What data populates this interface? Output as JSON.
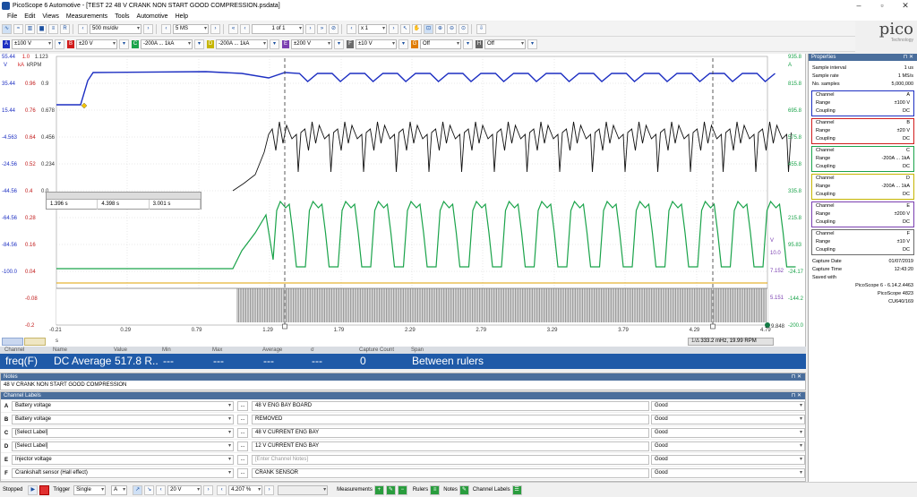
{
  "window": {
    "title": "PicoScope 6 Automotive - [TEST 22 48 V CRANK NON START GOOD COMPRESSION.psdata]",
    "logo_text": "pico",
    "logo_sub": "Technology"
  },
  "menu": [
    "File",
    "Edit",
    "Views",
    "Measurements",
    "Tools",
    "Automotive",
    "Help"
  ],
  "toolbar": {
    "timebase": "500 ms/div",
    "samples": "5 MS",
    "buffer": "1 of 1",
    "zoom": "x 1"
  },
  "channels_toolbar": [
    {
      "letter": "A",
      "range": "±100 V",
      "color": "#1d2fc2"
    },
    {
      "letter": "B",
      "range": "±20 V",
      "color": "#d11c1c"
    },
    {
      "letter": "C",
      "range": "-200A ... 1kA",
      "color": "#1aa34a"
    },
    {
      "letter": "D",
      "range": "-200A ... 1kA",
      "color": "#c6b500"
    },
    {
      "letter": "E",
      "range": "±200 V",
      "color": "#7a3fb0"
    },
    {
      "letter": "F",
      "range": "±10 V",
      "color": "#6b6b6b"
    },
    {
      "letter": "G",
      "range": "Off",
      "color": "#e07b00"
    },
    {
      "letter": "H",
      "range": "Off",
      "color": "#666666"
    }
  ],
  "scope": {
    "left_units": {
      "v1": "V",
      "v2": "kA",
      "v3": "kRPM"
    },
    "axis_a": [
      "35.44",
      "15.44",
      "-4.563",
      "-24.56",
      "-44.56",
      "-64.56",
      "-84.56",
      "-100.0"
    ],
    "axis_b": [
      "0.96",
      "0.76",
      "0.64",
      "0.52",
      "0.4",
      "0.28",
      "0.16",
      "0.04",
      "-0.08",
      "-0.2"
    ],
    "axis_c": [
      "0.9",
      "0.678",
      "0.456",
      "0.234",
      "0.0"
    ],
    "axis_top": {
      "a": "55.44",
      "b": "1.0",
      "c": "1.123"
    },
    "axis_right": [
      "815.8",
      "695.8",
      "575.8",
      "455.8",
      "335.8",
      "215.8",
      "95.83",
      "-24.17",
      "-144.2",
      "-200.0"
    ],
    "axis_right_top": "935.8",
    "axis_right_units": "A",
    "axis_right_b": [
      "10.0",
      "7.152",
      "5.151"
    ],
    "axis_right_b_unit": "V",
    "x_ticks": [
      "-0.21",
      "0.29",
      "0.79",
      "1.29",
      "1.79",
      "2.29",
      "2.79",
      "3.29",
      "3.79",
      "4.29",
      "4.79"
    ],
    "x_unit": "s",
    "ruler_box": {
      "c1": "1.396 s",
      "c2": "4.398 s",
      "c3": "3.001 s"
    },
    "freq_readout": "333.2 mHz, 19.99 RPM",
    "marker_end": "9.848"
  },
  "measurements": {
    "headers": [
      "Channel",
      "Name",
      "Value",
      "Min",
      "Max",
      "Average",
      "σ",
      "Capture Count",
      "Span"
    ],
    "row": [
      "freq(F)",
      "DC Average",
      "517.8 R...",
      "---",
      "---",
      "---",
      "---",
      "0",
      "Between rulers"
    ]
  },
  "notes": {
    "title": "Notes",
    "text": "48 V CRANK NON START GOOD COMPRESSION"
  },
  "channel_labels": {
    "title": "Channel Labels",
    "rows": [
      {
        "letter": "A",
        "label": "Battery voltage",
        "note": "48 V ENG BAY BOARD",
        "status": "Good"
      },
      {
        "letter": "B",
        "label": "Battery voltage",
        "note": "REMOVED",
        "status": "Good"
      },
      {
        "letter": "C",
        "label": "[Select Label]",
        "note": "48 V CURRENT ENG BAY",
        "status": "Good"
      },
      {
        "letter": "D",
        "label": "[Select Label]",
        "note": "12 V CURRENT ENG BAY",
        "status": "Good"
      },
      {
        "letter": "E",
        "label": "Injector voltage",
        "note": "[Enter Channel Notes]",
        "status": "Good"
      },
      {
        "letter": "F",
        "label": "Crankshaft sensor (Hall effect)",
        "note": "CRANK SENSOR",
        "status": "Good"
      }
    ],
    "more_btn": "..."
  },
  "statusbar": {
    "state": "Stopped",
    "trigger_label": "Trigger",
    "trigger_mode": "Single",
    "trigger_channel": "A",
    "trigger_level": "20 V",
    "pretrigger": "4.207 %",
    "measurements": "Measurements",
    "rulers": "Rulers",
    "notes": "Notes",
    "channel_labels": "Channel Labels"
  },
  "properties": {
    "title": "Properties",
    "general": [
      {
        "k": "Sample interval",
        "v": "1 us"
      },
      {
        "k": "Sample rate",
        "v": "1 MS/s"
      },
      {
        "k": "No. samples",
        "v": "5,000,000"
      }
    ],
    "channels": [
      {
        "channel": "A",
        "range": "±100 V",
        "coupling": "DC",
        "color": "#1d2fc2"
      },
      {
        "channel": "B",
        "range": "±20 V",
        "coupling": "DC",
        "color": "#d11c1c"
      },
      {
        "channel": "C",
        "range": "-200A ... 1kA",
        "coupling": "DC",
        "color": "#1aa34a"
      },
      {
        "channel": "D",
        "range": "-200A ... 1kA",
        "coupling": "DC",
        "color": "#c6b500"
      },
      {
        "channel": "E",
        "range": "±200 V",
        "coupling": "DC",
        "color": "#7a3fb0"
      },
      {
        "channel": "F",
        "range": "±10 V",
        "coupling": "DC",
        "color": "#6b6b6b"
      }
    ],
    "labels": {
      "channel": "Channel",
      "range": "Range",
      "coupling": "Coupling"
    },
    "capture_date_k": "Capture Date",
    "capture_date_v": "01/07/2019",
    "capture_time_k": "Capture Time",
    "capture_time_v": "12:43:20",
    "saved_with": "Saved with",
    "sw1": "PicoScope 6 - 6.14.2.4463",
    "sw2": "PicoScope 4823",
    "sw3": "CU640/169"
  }
}
